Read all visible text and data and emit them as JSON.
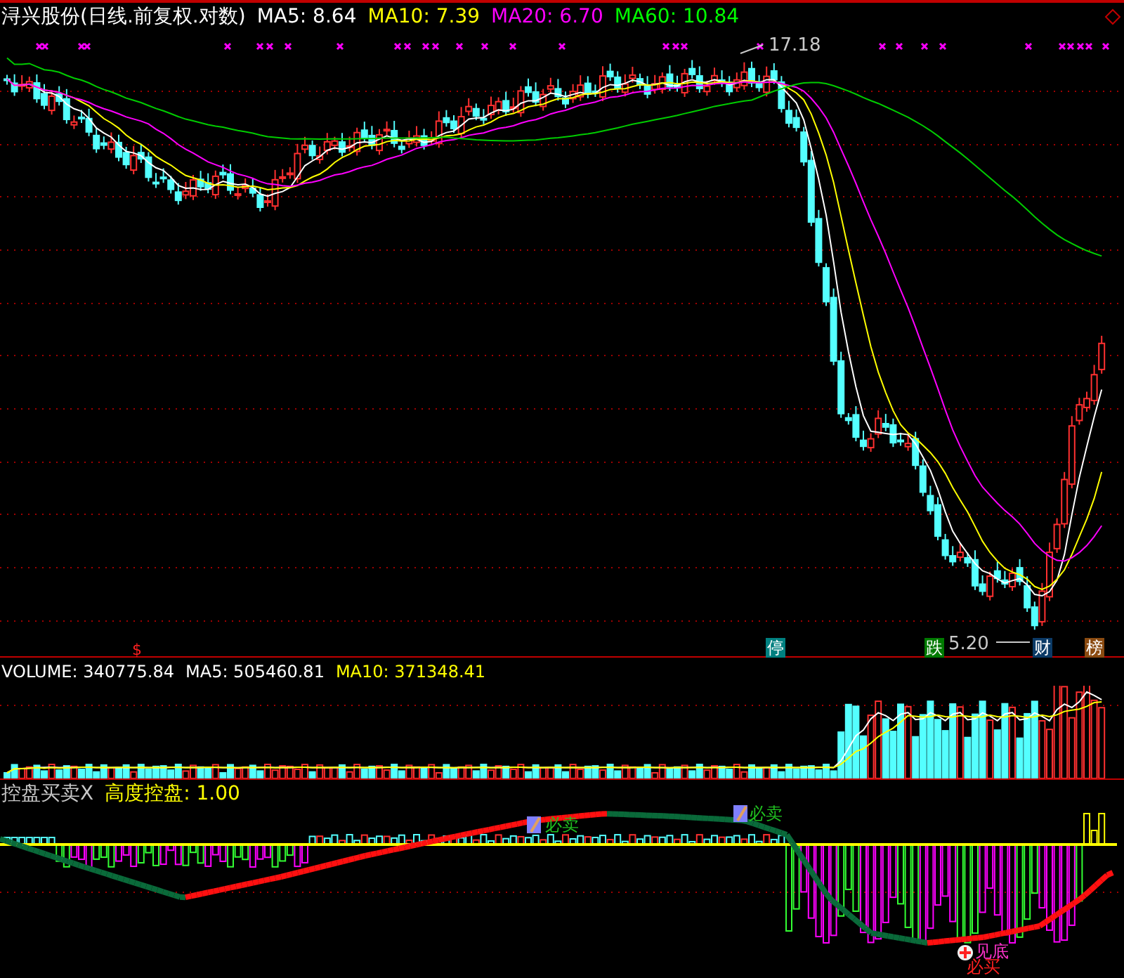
{
  "price_panel": {
    "title": "浔兴股份(日线.前复权.对数)",
    "indicators": [
      {
        "label": "MA5: 8.64",
        "color": "#ffffff"
      },
      {
        "label": "MA10: 7.39",
        "color": "#ffff00"
      },
      {
        "label": "MA20: 6.70",
        "color": "#ff00ff"
      },
      {
        "label": "MA60: 10.84",
        "color": "#00ff00"
      }
    ],
    "high_label": "17.18",
    "low_label": "5.20",
    "signal_mark": "$",
    "markers": [
      {
        "text": "停",
        "color": "#008080"
      },
      {
        "text": "跌",
        "color": "#007a00"
      },
      {
        "text": "财",
        "color": "#0b3a66"
      },
      {
        "text": "榜",
        "color": "#8a4a10"
      }
    ]
  },
  "volume_panel": {
    "indicators": [
      {
        "label": "VOLUME: 340775.84",
        "color": "#ffffff"
      },
      {
        "label": "MA5: 505460.81",
        "color": "#ffffff"
      },
      {
        "label": "MA10: 371348.41",
        "color": "#ffff00"
      }
    ]
  },
  "control_panel": {
    "title": "控盘买卖X",
    "indicators": [
      {
        "label": "高度控盘: 1.00",
        "color": "#ffff00"
      }
    ],
    "signals": [
      {
        "text": "必卖",
        "color": "#20c020"
      },
      {
        "text": "必卖",
        "color": "#20c020"
      },
      {
        "text": "见底",
        "color": "#ff33cc"
      },
      {
        "text": "必买",
        "color": "#ff2020"
      }
    ]
  }
}
